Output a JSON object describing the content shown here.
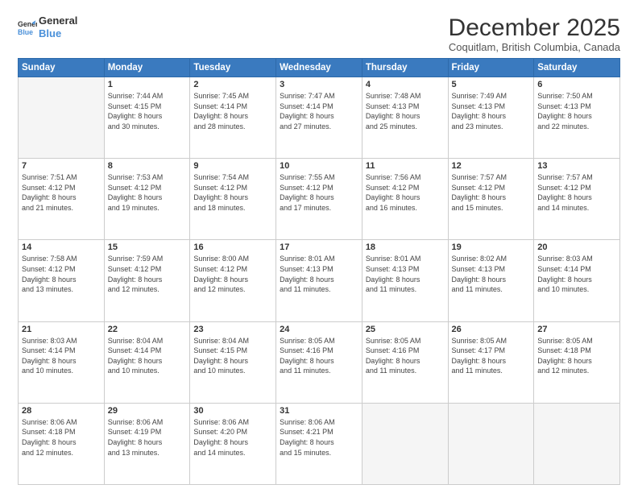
{
  "logo": {
    "line1": "General",
    "line2": "Blue"
  },
  "title": "December 2025",
  "subtitle": "Coquitlam, British Columbia, Canada",
  "days_header": [
    "Sunday",
    "Monday",
    "Tuesday",
    "Wednesday",
    "Thursday",
    "Friday",
    "Saturday"
  ],
  "weeks": [
    [
      {
        "day": "",
        "info": ""
      },
      {
        "day": "1",
        "info": "Sunrise: 7:44 AM\nSunset: 4:15 PM\nDaylight: 8 hours\nand 30 minutes."
      },
      {
        "day": "2",
        "info": "Sunrise: 7:45 AM\nSunset: 4:14 PM\nDaylight: 8 hours\nand 28 minutes."
      },
      {
        "day": "3",
        "info": "Sunrise: 7:47 AM\nSunset: 4:14 PM\nDaylight: 8 hours\nand 27 minutes."
      },
      {
        "day": "4",
        "info": "Sunrise: 7:48 AM\nSunset: 4:13 PM\nDaylight: 8 hours\nand 25 minutes."
      },
      {
        "day": "5",
        "info": "Sunrise: 7:49 AM\nSunset: 4:13 PM\nDaylight: 8 hours\nand 23 minutes."
      },
      {
        "day": "6",
        "info": "Sunrise: 7:50 AM\nSunset: 4:13 PM\nDaylight: 8 hours\nand 22 minutes."
      }
    ],
    [
      {
        "day": "7",
        "info": "Sunrise: 7:51 AM\nSunset: 4:12 PM\nDaylight: 8 hours\nand 21 minutes."
      },
      {
        "day": "8",
        "info": "Sunrise: 7:53 AM\nSunset: 4:12 PM\nDaylight: 8 hours\nand 19 minutes."
      },
      {
        "day": "9",
        "info": "Sunrise: 7:54 AM\nSunset: 4:12 PM\nDaylight: 8 hours\nand 18 minutes."
      },
      {
        "day": "10",
        "info": "Sunrise: 7:55 AM\nSunset: 4:12 PM\nDaylight: 8 hours\nand 17 minutes."
      },
      {
        "day": "11",
        "info": "Sunrise: 7:56 AM\nSunset: 4:12 PM\nDaylight: 8 hours\nand 16 minutes."
      },
      {
        "day": "12",
        "info": "Sunrise: 7:57 AM\nSunset: 4:12 PM\nDaylight: 8 hours\nand 15 minutes."
      },
      {
        "day": "13",
        "info": "Sunrise: 7:57 AM\nSunset: 4:12 PM\nDaylight: 8 hours\nand 14 minutes."
      }
    ],
    [
      {
        "day": "14",
        "info": "Sunrise: 7:58 AM\nSunset: 4:12 PM\nDaylight: 8 hours\nand 13 minutes."
      },
      {
        "day": "15",
        "info": "Sunrise: 7:59 AM\nSunset: 4:12 PM\nDaylight: 8 hours\nand 12 minutes."
      },
      {
        "day": "16",
        "info": "Sunrise: 8:00 AM\nSunset: 4:12 PM\nDaylight: 8 hours\nand 12 minutes."
      },
      {
        "day": "17",
        "info": "Sunrise: 8:01 AM\nSunset: 4:13 PM\nDaylight: 8 hours\nand 11 minutes."
      },
      {
        "day": "18",
        "info": "Sunrise: 8:01 AM\nSunset: 4:13 PM\nDaylight: 8 hours\nand 11 minutes."
      },
      {
        "day": "19",
        "info": "Sunrise: 8:02 AM\nSunset: 4:13 PM\nDaylight: 8 hours\nand 11 minutes."
      },
      {
        "day": "20",
        "info": "Sunrise: 8:03 AM\nSunset: 4:14 PM\nDaylight: 8 hours\nand 10 minutes."
      }
    ],
    [
      {
        "day": "21",
        "info": "Sunrise: 8:03 AM\nSunset: 4:14 PM\nDaylight: 8 hours\nand 10 minutes."
      },
      {
        "day": "22",
        "info": "Sunrise: 8:04 AM\nSunset: 4:14 PM\nDaylight: 8 hours\nand 10 minutes."
      },
      {
        "day": "23",
        "info": "Sunrise: 8:04 AM\nSunset: 4:15 PM\nDaylight: 8 hours\nand 10 minutes."
      },
      {
        "day": "24",
        "info": "Sunrise: 8:05 AM\nSunset: 4:16 PM\nDaylight: 8 hours\nand 11 minutes."
      },
      {
        "day": "25",
        "info": "Sunrise: 8:05 AM\nSunset: 4:16 PM\nDaylight: 8 hours\nand 11 minutes."
      },
      {
        "day": "26",
        "info": "Sunrise: 8:05 AM\nSunset: 4:17 PM\nDaylight: 8 hours\nand 11 minutes."
      },
      {
        "day": "27",
        "info": "Sunrise: 8:05 AM\nSunset: 4:18 PM\nDaylight: 8 hours\nand 12 minutes."
      }
    ],
    [
      {
        "day": "28",
        "info": "Sunrise: 8:06 AM\nSunset: 4:18 PM\nDaylight: 8 hours\nand 12 minutes."
      },
      {
        "day": "29",
        "info": "Sunrise: 8:06 AM\nSunset: 4:19 PM\nDaylight: 8 hours\nand 13 minutes."
      },
      {
        "day": "30",
        "info": "Sunrise: 8:06 AM\nSunset: 4:20 PM\nDaylight: 8 hours\nand 14 minutes."
      },
      {
        "day": "31",
        "info": "Sunrise: 8:06 AM\nSunset: 4:21 PM\nDaylight: 8 hours\nand 15 minutes."
      },
      {
        "day": "",
        "info": ""
      },
      {
        "day": "",
        "info": ""
      },
      {
        "day": "",
        "info": ""
      }
    ]
  ]
}
